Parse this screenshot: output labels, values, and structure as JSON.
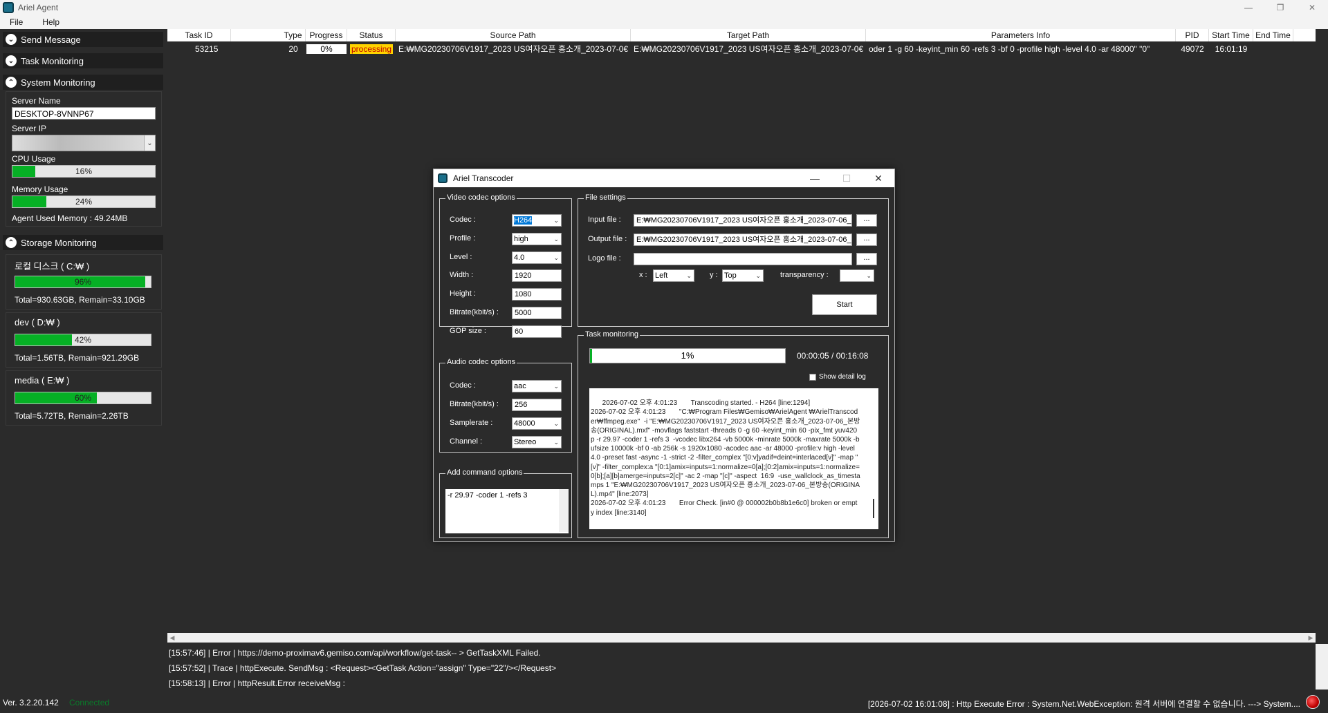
{
  "window": {
    "title": "Ariel Agent",
    "minimize": "—",
    "maximize": "❐",
    "close": "✕"
  },
  "menu": {
    "file": "File",
    "help": "Help"
  },
  "left": {
    "send_message": "Send Message",
    "task_monitoring": "Task Monitoring",
    "system_monitoring": "System Monitoring",
    "server_name_label": "Server Name",
    "server_name": "DESKTOP-8VNNP67",
    "server_ip_label": "Server IP",
    "cpu_label": "CPU Usage",
    "cpu_value": "16%",
    "cpu_fraction": 0.16,
    "memory_label": "Memory Usage",
    "memory_value": "24%",
    "memory_fraction": 0.24,
    "agent_memory": "Agent Used Memory : 49.24MB",
    "storage_monitoring": "Storage Monitoring",
    "storages": [
      {
        "name": "로컬 디스크 ( C:₩ )",
        "percent": "96%",
        "fraction": 0.96,
        "total": "Total=930.63GB, Remain=33.10GB"
      },
      {
        "name": "dev ( D:₩ )",
        "percent": "42%",
        "fraction": 0.42,
        "total": "Total=1.56TB, Remain=921.29GB"
      },
      {
        "name": "media ( E:₩ )",
        "percent": "60%",
        "fraction": 0.6,
        "total": "Total=5.72TB, Remain=2.26TB"
      }
    ]
  },
  "list": {
    "columns": [
      "Task ID",
      "Type",
      "Progress",
      "Status",
      "Source Path",
      "Target Path",
      "Parameters Info",
      "PID",
      "Start Time",
      "End Time"
    ],
    "row": {
      "task_id": "53215",
      "type": "20",
      "progress": "0%",
      "status": "processing",
      "source": "E:₩MG20230706V1917_2023 US여자오픈 홍소개_2023-07-0€",
      "target": "E:₩MG20230706V1917_2023 US여자오픈 홍소개_2023-07-0€",
      "params": "oder 1 -g 60 -keyint_min 60 -refs 3 -bf 0 -profile high -level 4.0 -ar 48000\" \"0\"",
      "pid": "49072",
      "start": "16:01:19",
      "end": ""
    }
  },
  "logs": [
    "[15:57:46] | Error | https://demo-proximav6.gemiso.com/api/workflow/get-task-- > GetTaskXML Failed.",
    "[15:57:52] | Trace | httpExecute. SendMsg : <Request><GetTask Action=\"assign\" Type=\"22\"/></Request>",
    "[15:58:13] | Error | httpResult.Error receiveMsg :"
  ],
  "status": {
    "version": "Ver. 3.2.20.142",
    "connection": "Connected",
    "message": "[2026-07-02 16:01:08] : Http Execute Error : System.Net.WebException: 원격 서버에 연결할 수 없습니다. ---> System...."
  },
  "dialog": {
    "title": "Ariel Transcoder",
    "video": {
      "legend": "Video codec options",
      "codec_label": "Codec :",
      "codec": "H264",
      "profile_label": "Profile :",
      "profile": "high",
      "level_label": "Level :",
      "level": "4.0",
      "width_label": "Width :",
      "width": "1920",
      "height_label": "Height :",
      "height": "1080",
      "bitrate_label": "Bitrate(kbit/s) :",
      "bitrate": "5000",
      "gop_label": "GOP size :",
      "gop": "60"
    },
    "audio": {
      "legend": "Audio codec options",
      "codec_label": "Codec :",
      "codec": "aac",
      "bitrate_label": "Bitrate(kbit/s) :",
      "bitrate": "256",
      "samplerate_label": "Samplerate :",
      "samplerate": "48000",
      "channel_label": "Channel :",
      "channel": "Stereo"
    },
    "command": {
      "legend": "Add command options",
      "value": "-r 29.97 -coder 1 -refs 3"
    },
    "file": {
      "legend": "File settings",
      "input_label": "Input file :",
      "input": "E:₩MG20230706V1917_2023 US여자오픈 홍소개_2023-07-06_",
      "output_label": "Output file :",
      "output": "E:₩MG20230706V1917_2023 US여자오픈 홍소개_2023-07-06_",
      "logo_label": "Logo file :",
      "logo": "",
      "browse": "...",
      "x_label": "x :",
      "x": "Left",
      "y_label": "y :",
      "y": "Top",
      "transparency_label": "transparency :",
      "transparency": "",
      "start": "Start"
    },
    "task": {
      "legend": "Task monitoring",
      "progress": "1%",
      "progress_fraction": 0.01,
      "time": "00:00:05 / 00:16:08",
      "show_detail": "Show detail log",
      "log": "2026-07-02 오후 4:01:23       Transcoding started. - H264 [line:1294]\n2026-07-02 오후 4:01:23       \"C:₩Program Files₩Gemiso₩ArielAgent ₩ArielTranscoder₩ffmpeg.exe\"  -i \"E:₩MG20230706V1917_2023 US여자오픈 홍소개_2023-07-06_본방송(ORIGINAL).mxf\" -movflags faststart -threads 0 -g 60 -keyint_min 60 -pix_fmt yuv420p -r 29.97 -coder 1 -refs 3  -vcodec libx264 -vb 5000k -minrate 5000k -maxrate 5000k -bufsize 10000k -bf 0 -ab 256k -s 1920x1080 -acodec aac -ar 48000 -profile:v high -level 4.0 -preset fast -async -1 -strict -2 -filter_complex \"[0:v]yadif=deint=interlaced[v]\" -map \"[v]\" -filter_complex:a \"[0:1]amix=inputs=1:normalize=0[a];[0:2]amix=inputs=1:normalize=0[b];[a][b]amerge=inputs=2[c]\" -ac 2 -map \"[c]\" -aspect  16:9  -use_wallclock_as_timestamps 1 \"E:₩MG20230706V1917_2023 US여자오픈 홍소개_2023-07-06_본방송(ORIGINAL).mp4\" [line:2073]\n2026-07-02 오후 4:01:23       Error Check. [in#0 @ 000002b0b8b1e6c0] broken or empty index [line:3140]"
    }
  }
}
